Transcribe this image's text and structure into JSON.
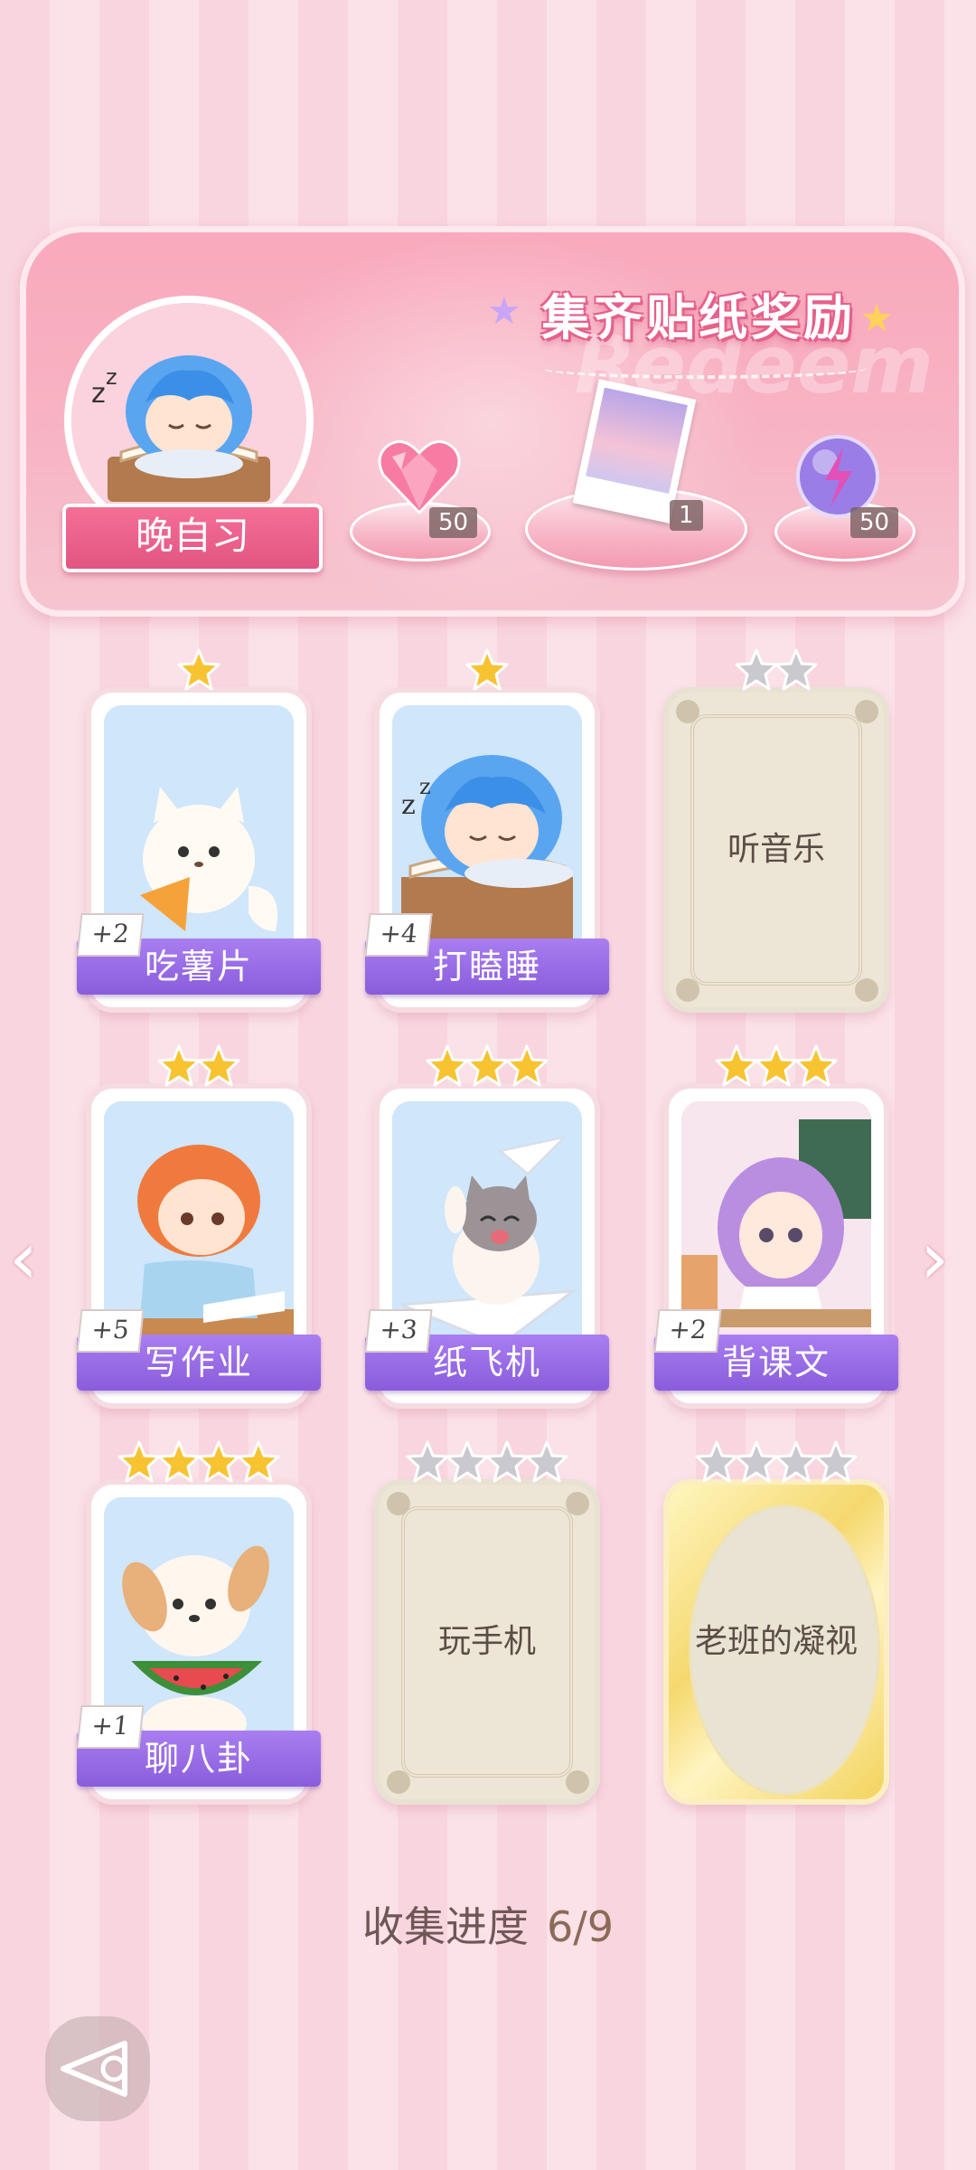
{
  "banner": {
    "title": "集齐贴纸奖励",
    "watermark": "Redeem",
    "character_name": "晚自习",
    "rewards": [
      {
        "icon": "heart-gem-icon",
        "count": "50"
      },
      {
        "icon": "photo-card-icon",
        "count": "1"
      },
      {
        "icon": "lightning-orb-icon",
        "count": "50"
      }
    ]
  },
  "cards": [
    {
      "label": "吃薯片",
      "bonus": "+2",
      "stars": 1,
      "collected": true,
      "art": "white-cat-eating-chips"
    },
    {
      "label": "打瞌睡",
      "bonus": "+4",
      "stars": 1,
      "collected": true,
      "art": "boy-sleeping-on-book"
    },
    {
      "label": "听音乐",
      "stars": 2,
      "collected": false
    },
    {
      "label": "写作业",
      "bonus": "+5",
      "stars": 2,
      "collected": true,
      "art": "boy-doing-homework"
    },
    {
      "label": "纸飞机",
      "bonus": "+3",
      "stars": 3,
      "collected": true,
      "art": "cat-on-paper-plane"
    },
    {
      "label": "背课文",
      "bonus": "+2",
      "stars": 3,
      "collected": true,
      "art": "girl-reciting-text"
    },
    {
      "label": "聊八卦",
      "bonus": "+1",
      "stars": 4,
      "collected": true,
      "art": "puppy-eating-watermelon"
    },
    {
      "label": "玩手机",
      "stars": 4,
      "collected": false
    },
    {
      "label": "老班的凝视",
      "stars": 4,
      "collected": false,
      "gold": true
    }
  ],
  "progress": {
    "label": "收集进度",
    "value": "6/9"
  },
  "colors": {
    "accent_pink": "#f46f96",
    "label_purple": "#8a5cdc",
    "star_gold": "#f7c331",
    "star_silver": "#c9c9cf"
  }
}
